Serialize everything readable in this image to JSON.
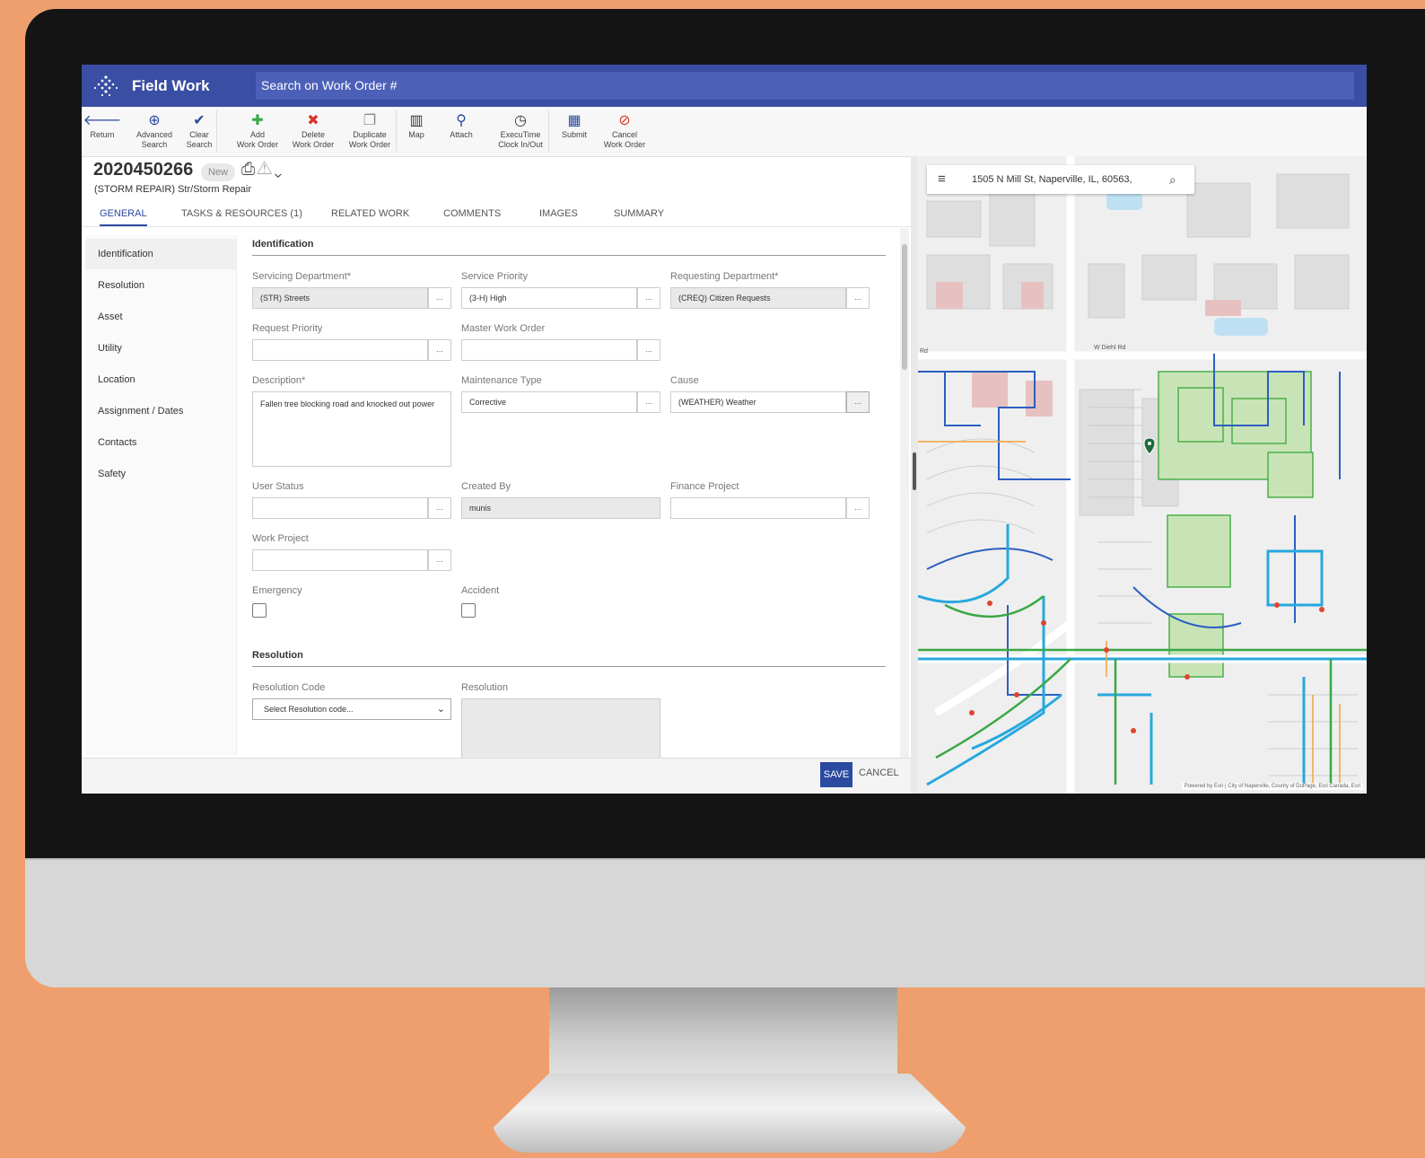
{
  "app": {
    "title": "Field Work",
    "search_placeholder": "Search on Work Order #"
  },
  "toolbar": [
    {
      "icon": "arrow-left-icon",
      "glyph": "🡐",
      "label": "Return",
      "color": "#2b4aa0"
    },
    {
      "icon": "advanced-search-icon",
      "glyph": "⊕",
      "label": "Advanced\nSearch",
      "color": "#2b4aa0"
    },
    {
      "icon": "brush-icon",
      "glyph": "✔",
      "label": "Clear\nSearch",
      "color": "#2b4aa0"
    },
    {
      "icon": "plus-icon",
      "glyph": "✚",
      "label": "Add\nWork Order",
      "color": "#3aa845"
    },
    {
      "icon": "x-icon",
      "glyph": "✖",
      "label": "Delete\nWork Order",
      "color": "#d9342b"
    },
    {
      "icon": "copy-icon",
      "glyph": "❐",
      "label": "Duplicate\nWork Order",
      "color": "#888888"
    },
    {
      "icon": "map-icon",
      "glyph": "▥",
      "label": "Map",
      "color": "#333333"
    },
    {
      "icon": "paperclip-icon",
      "glyph": "⚲",
      "label": "Attach",
      "color": "#2b4aa0"
    },
    {
      "icon": "clock-icon",
      "glyph": "◷",
      "label": "ExecuTime\nClock In/Out",
      "color": "#333333"
    },
    {
      "icon": "submit-icon",
      "glyph": "▦",
      "label": "Submit",
      "color": "#2b4aa0"
    },
    {
      "icon": "cancel-circle-icon",
      "glyph": "⊘",
      "label": "Cancel\nWork Order",
      "color": "#d9342b"
    }
  ],
  "work_order": {
    "number": "2020450266",
    "status": "New",
    "subtitle": "(STORM REPAIR) Str/Storm Repair"
  },
  "tabs": [
    {
      "label": "GENERAL",
      "active": true
    },
    {
      "label": "TASKS & RESOURCES (1)",
      "active": false
    },
    {
      "label": "RELATED WORK",
      "active": false
    },
    {
      "label": "COMMENTS",
      "active": false
    },
    {
      "label": "IMAGES",
      "active": false
    },
    {
      "label": "SUMMARY",
      "active": false
    }
  ],
  "sidenav": [
    "Identification",
    "Resolution",
    "Asset",
    "Utility",
    "Location",
    "Assignment / Dates",
    "Contacts",
    "Safety"
  ],
  "form": {
    "identification_title": "Identification",
    "servicing_department": {
      "label": "Servicing Department*",
      "value": "(STR) Streets"
    },
    "service_priority": {
      "label": "Service Priority",
      "value": "(3-H) High"
    },
    "requesting_department": {
      "label": "Requesting Department*",
      "value": "(CREQ) Citizen Requests"
    },
    "request_priority": {
      "label": "Request Priority",
      "value": ""
    },
    "master_work_order": {
      "label": "Master Work Order",
      "value": ""
    },
    "description": {
      "label": "Description*",
      "value": "Fallen tree blocking road and knocked out power"
    },
    "maintenance_type": {
      "label": "Maintenance Type",
      "value": "Corrective"
    },
    "cause": {
      "label": "Cause",
      "value": "(WEATHER) Weather"
    },
    "user_status": {
      "label": "User Status",
      "value": ""
    },
    "created_by": {
      "label": "Created By",
      "value": "munis"
    },
    "finance_project": {
      "label": "Finance Project",
      "value": ""
    },
    "work_project": {
      "label": "Work Project",
      "value": ""
    },
    "emergency": {
      "label": "Emergency",
      "checked": false
    },
    "accident": {
      "label": "Accident",
      "checked": false
    },
    "resolution_title": "Resolution",
    "resolution_code": {
      "label": "Resolution Code",
      "placeholder": "Select Resolution code..."
    },
    "resolution": {
      "label": "Resolution",
      "value": ""
    },
    "lookup_button": "..."
  },
  "footer": {
    "save": "SAVE",
    "cancel": "CANCEL"
  },
  "map": {
    "address": "1505 N Mill St, Naperville, IL, 60563,",
    "attribution": "Powered by Esri | City of Naperville, County of DuPage, Esri Canada, Esri",
    "street_labels": [
      "W Diehl Rd",
      "Rd"
    ],
    "colors": {
      "water_main": "#3a7fd0",
      "sewer": "#1fa0d8",
      "storm": "#3aa845",
      "parcel": "#c0c0c0"
    }
  }
}
